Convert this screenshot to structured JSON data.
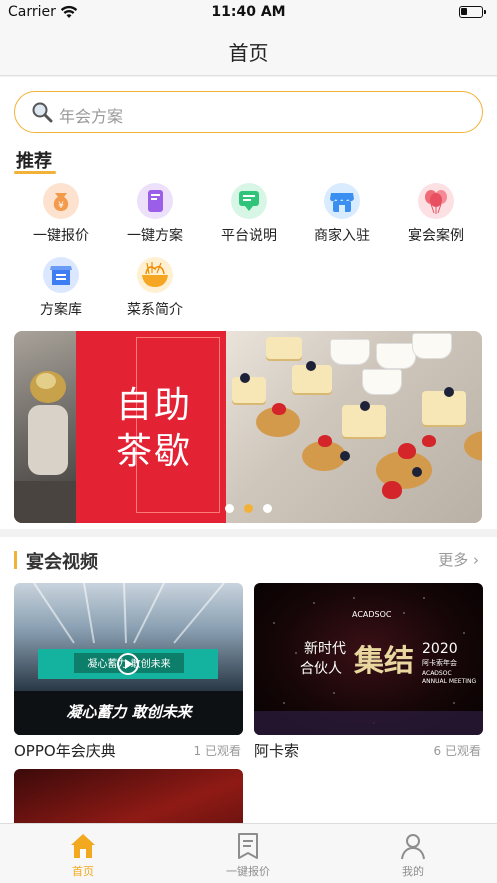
{
  "status_bar": {
    "carrier": "Carrier",
    "time": "11:40 AM"
  },
  "nav": {
    "title": "首页"
  },
  "search": {
    "placeholder": "年会方案"
  },
  "recommend": {
    "title": "推荐",
    "items": [
      {
        "label": "一键报价",
        "icon": "money-bag-icon"
      },
      {
        "label": "一键方案",
        "icon": "document-icon"
      },
      {
        "label": "平台说明",
        "icon": "chat-bubble-icon"
      },
      {
        "label": "商家入驻",
        "icon": "shop-icon"
      },
      {
        "label": "宴会案例",
        "icon": "balloons-icon"
      },
      {
        "label": "方案库",
        "icon": "archive-icon"
      },
      {
        "label": "菜系简介",
        "icon": "noodles-icon"
      }
    ]
  },
  "banner": {
    "text_line1": "自助",
    "text_line2": "茶歇",
    "slides": 3,
    "active_slide": 1
  },
  "videos": {
    "title": "宴会视频",
    "more": "更多",
    "items": [
      {
        "title": "OPPO年会庆典",
        "views": "1 已观看",
        "stage_caption": "凝心蓄力 敢创未来",
        "screen_text": "凝心蓄力 敢创未来"
      },
      {
        "title": "阿卡索",
        "views": "6 已观看",
        "brand": "ACADSOC",
        "line1": "新时代",
        "line2": "合伙人",
        "big_char": "集结",
        "year": "2020",
        "sub": "阿卡索年会",
        "sub2": "ACADSOC",
        "sub3": "ANNUAL MEETING"
      },
      {
        "title": "",
        "views": ""
      }
    ]
  },
  "tab_bar": {
    "tabs": [
      {
        "label": "首页",
        "active": true
      },
      {
        "label": "一键报价",
        "active": false
      },
      {
        "label": "我的",
        "active": false
      }
    ]
  },
  "colors": {
    "accent": "#f2b23a",
    "tab_active": "#f2a91f",
    "banner_red": "#e32234"
  }
}
